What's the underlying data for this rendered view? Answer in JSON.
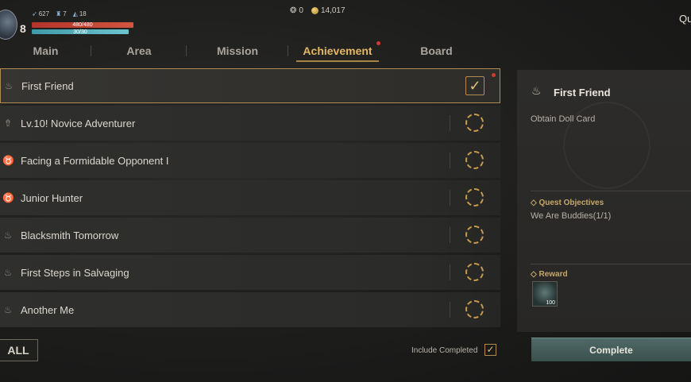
{
  "hud": {
    "level": "8",
    "stat1": "627",
    "stat2": "7",
    "stat3": "18",
    "hp": "480/480",
    "mp": "30/30",
    "currency1": "0",
    "currency2": "14,017",
    "quit": "Qu"
  },
  "tabs": [
    {
      "label": "Main"
    },
    {
      "label": "Area"
    },
    {
      "label": "Mission"
    },
    {
      "label": "Achievement"
    },
    {
      "label": "Board"
    }
  ],
  "list": [
    {
      "label": "First Friend",
      "icon": "lamp-icon"
    },
    {
      "label": "Lv.10! Novice Adventurer",
      "icon": "pin-icon"
    },
    {
      "label": "Facing a Formidable Opponent I",
      "icon": "bull-icon"
    },
    {
      "label": "Junior Hunter",
      "icon": "bull-icon"
    },
    {
      "label": "Blacksmith Tomorrow",
      "icon": "lamp-icon"
    },
    {
      "label": "First Steps in Salvaging",
      "icon": "lamp-icon"
    },
    {
      "label": "Another Me",
      "icon": "lamp-icon"
    }
  ],
  "controls": {
    "all": "ALL",
    "include_completed": "Include Completed"
  },
  "detail": {
    "title": "First Friend",
    "description": "Obtain Doll Card",
    "objectives_heading": "Quest Objectives",
    "objective": "We Are Buddies(1/1)",
    "reward_heading": "Reward",
    "reward_qty": "100",
    "complete": "Complete"
  },
  "colors": {
    "accent": "#e2b865",
    "alert": "#d33a2f"
  }
}
